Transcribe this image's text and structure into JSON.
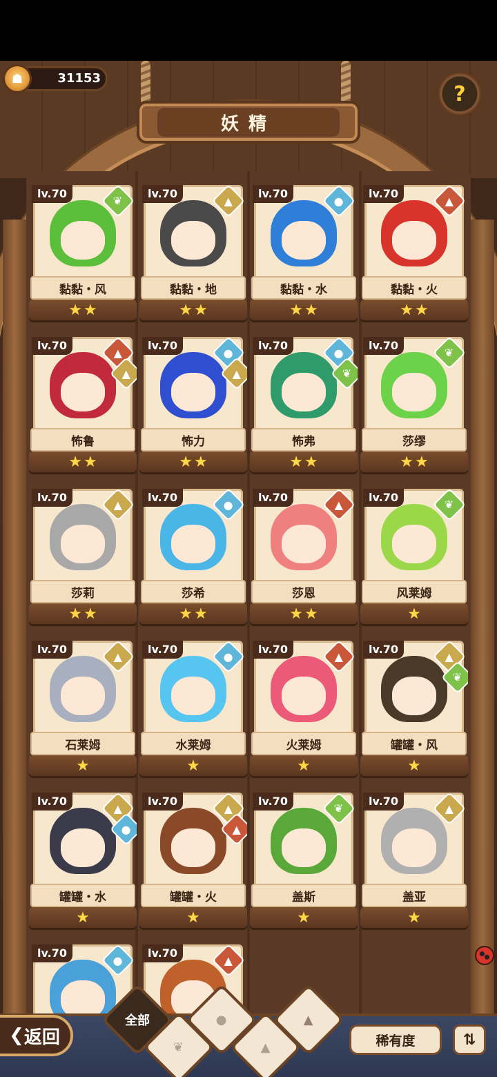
{
  "currency": {
    "icon": "coin-icon",
    "value": "31153"
  },
  "title": "妖精",
  "help": {
    "icon": "question-icon",
    "glyph": "?"
  },
  "colors": {
    "grass": "#7fc24a",
    "earth": "#c9a84e",
    "water": "#5fb6d9",
    "fire": "#c9573a"
  },
  "elements": {
    "grass": {
      "glyph": "❦",
      "color": "#7fc24a"
    },
    "earth": {
      "glyph": "▲",
      "color": "#c9a84e"
    },
    "water": {
      "glyph": "●",
      "color": "#5fb6d9"
    },
    "fire": {
      "glyph": "▲",
      "color": "#c9573a"
    }
  },
  "fairies": [
    {
      "level": "lv.70",
      "name": "黏黏・风",
      "stars": 2,
      "elements": [
        "grass"
      ],
      "hair": "#5cbf3c"
    },
    {
      "level": "lv.70",
      "name": "黏黏・地",
      "stars": 2,
      "elements": [
        "earth"
      ],
      "hair": "#4a4a4a"
    },
    {
      "level": "lv.70",
      "name": "黏黏・水",
      "stars": 2,
      "elements": [
        "water"
      ],
      "hair": "#2f7fd8"
    },
    {
      "level": "lv.70",
      "name": "黏黏・火",
      "stars": 2,
      "elements": [
        "fire"
      ],
      "hair": "#d8342b"
    },
    {
      "level": "lv.70",
      "name": "怖鲁",
      "stars": 2,
      "elements": [
        "fire",
        "earth"
      ],
      "hair": "#c02a3a"
    },
    {
      "level": "lv.70",
      "name": "怖力",
      "stars": 2,
      "elements": [
        "water",
        "earth"
      ],
      "hair": "#2f4fd0"
    },
    {
      "level": "lv.70",
      "name": "怖弗",
      "stars": 2,
      "elements": [
        "water",
        "grass"
      ],
      "hair": "#2f9a6a"
    },
    {
      "level": "lv.70",
      "name": "莎缪",
      "stars": 2,
      "elements": [
        "grass"
      ],
      "hair": "#6cd24a"
    },
    {
      "level": "lv.70",
      "name": "莎莉",
      "stars": 2,
      "elements": [
        "earth"
      ],
      "hair": "#a8a8a8"
    },
    {
      "level": "lv.70",
      "name": "莎希",
      "stars": 2,
      "elements": [
        "water"
      ],
      "hair": "#4ab6e8"
    },
    {
      "level": "lv.70",
      "name": "莎恩",
      "stars": 2,
      "elements": [
        "fire"
      ],
      "hair": "#f08080"
    },
    {
      "level": "lv.70",
      "name": "风莱姆",
      "stars": 1,
      "elements": [
        "grass"
      ],
      "hair": "#9ad84a"
    },
    {
      "level": "lv.70",
      "name": "石莱姆",
      "stars": 1,
      "elements": [
        "earth"
      ],
      "hair": "#a8b0c0"
    },
    {
      "level": "lv.70",
      "name": "水莱姆",
      "stars": 1,
      "elements": [
        "water"
      ],
      "hair": "#56c6f0"
    },
    {
      "level": "lv.70",
      "name": "火莱姆",
      "stars": 1,
      "elements": [
        "fire"
      ],
      "hair": "#ec5a7a"
    },
    {
      "level": "lv.70",
      "name": "罐罐・风",
      "stars": 1,
      "elements": [
        "earth",
        "grass"
      ],
      "hair": "#4a3a2a"
    },
    {
      "level": "lv.70",
      "name": "罐罐・水",
      "stars": 1,
      "elements": [
        "earth",
        "water"
      ],
      "hair": "#3a3a4a"
    },
    {
      "level": "lv.70",
      "name": "罐罐・火",
      "stars": 1,
      "elements": [
        "earth",
        "fire"
      ],
      "hair": "#8a4a2a"
    },
    {
      "level": "lv.70",
      "name": "盖斯",
      "stars": 1,
      "elements": [
        "grass"
      ],
      "hair": "#5aa83a"
    },
    {
      "level": "lv.70",
      "name": "盖亚",
      "stars": 1,
      "elements": [
        "earth"
      ],
      "hair": "#b0b0b0"
    },
    {
      "level": "lv.70",
      "name": "",
      "stars": 0,
      "elements": [
        "water"
      ],
      "hair": "#4aa0d8"
    },
    {
      "level": "lv.70",
      "name": "",
      "stars": 0,
      "elements": [
        "fire"
      ],
      "hair": "#c0602a"
    }
  ],
  "bottom": {
    "back_label": "返回",
    "filters": [
      {
        "label": "全部",
        "icon": "all-filter-icon"
      },
      {
        "label": "",
        "icon": "grass-filter-icon"
      },
      {
        "label": "",
        "icon": "water-filter-icon"
      },
      {
        "label": "",
        "icon": "earth-filter-icon"
      },
      {
        "label": "",
        "icon": "fire-filter-icon"
      }
    ],
    "rarity_label": "稀有度",
    "sort_icon": "sort-icon"
  }
}
